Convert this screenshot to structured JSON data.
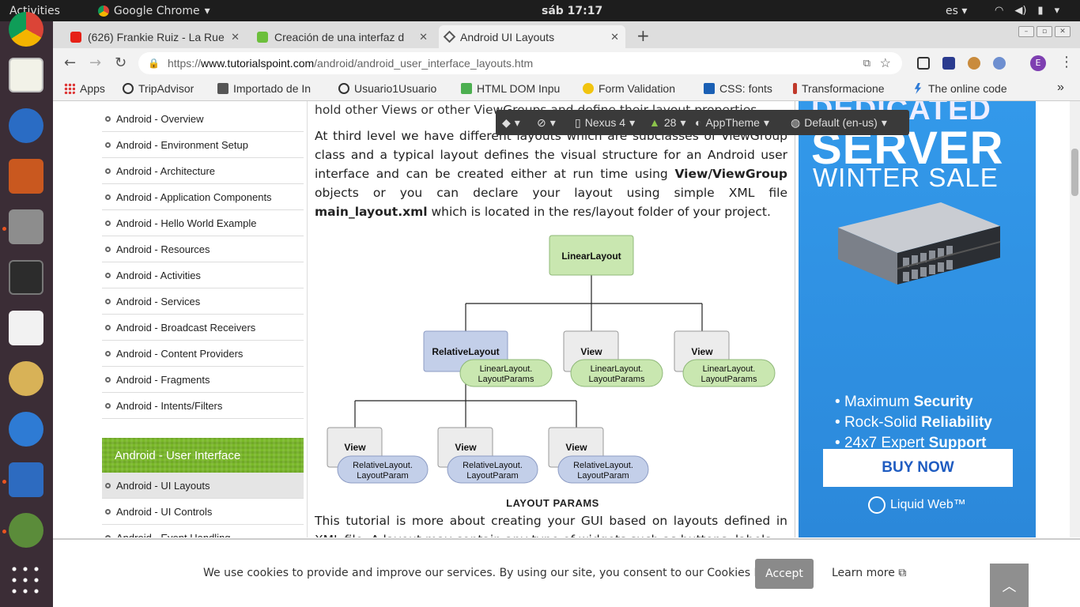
{
  "system": {
    "activities": "Activities",
    "app_name": "Google Chrome",
    "clock": "sáb 17:17",
    "language": "es"
  },
  "tabs": [
    {
      "title": "(626) Frankie Ruiz - La Rue",
      "icon": "youtube-icon"
    },
    {
      "title": "Creación de una interfaz d",
      "icon": "android-icon"
    },
    {
      "title": "Android UI Layouts",
      "icon": "tutorialspoint-icon",
      "active": true
    }
  ],
  "address": {
    "protocol": "https://",
    "host": "www.tutorialspoint.com",
    "path": "/android/android_user_interface_layouts.htm"
  },
  "bookmarks": [
    {
      "label": "Apps",
      "icon": "apps-grid-icon"
    },
    {
      "label": "TripAdvisor",
      "icon": "tripadvisor-icon"
    },
    {
      "label": "Importado de In",
      "icon": "folder-icon"
    },
    {
      "label": "Usuario1Usuario",
      "icon": "smiley-icon"
    },
    {
      "label": "HTML DOM Inpu",
      "icon": "w3-icon"
    },
    {
      "label": "Form Validation",
      "icon": "bulb-icon"
    },
    {
      "label": "CSS: fonts",
      "icon": "w3-icon"
    },
    {
      "label": "Transformacione",
      "icon": "info-icon"
    },
    {
      "label": "The online code",
      "icon": "bolt-icon"
    }
  ],
  "sidebar": {
    "items_top": [
      "Android - Overview",
      "Android - Environment Setup",
      "Android - Architecture",
      "Android - Application Components",
      "Android - Hello World Example",
      "Android - Resources",
      "Android - Activities",
      "Android - Services",
      "Android - Broadcast Receivers",
      "Android - Content Providers",
      "Android - Fragments",
      "Android - Intents/Filters"
    ],
    "section_header": "Android - User Interface",
    "items_bottom": [
      "Android - UI Layouts",
      "Android - UI Controls",
      "Android - Event Handling"
    ]
  },
  "content": {
    "para0": "hold other Views or other ViewGroups and define their layout properties.",
    "para1_a": "At third level we have different layouts which are subclasses of ViewGroup class and a typical layout defines the visual structure for an Android user interface and can be created either at run time using ",
    "para1_b": "View/ViewGroup",
    "para1_c": " objects or you can declare your layout using simple XML file ",
    "para1_d": "main_layout.xml",
    "para1_e": " which is located in the res/layout folder of your project.",
    "diagram": {
      "root": "LinearLayout",
      "level2": [
        "RelativeLayout",
        "View",
        "View"
      ],
      "level2_params": [
        "LinearLayout.",
        "LayoutParams"
      ],
      "level3": [
        "View",
        "View",
        "View"
      ],
      "level3_params": [
        "RelativeLayout.",
        "LayoutParam"
      ],
      "caption": "LAYOUT PARAMS"
    },
    "para2": "This tutorial is more about creating your GUI based on layouts defined in XML file. A layout may contain any type of widgets such as buttons, labels,"
  },
  "devtools": {
    "device": "Nexus 4",
    "api": "28",
    "theme": "AppTheme",
    "locale": "Default (en-us)"
  },
  "ad": {
    "line1": "DEDICATED",
    "line2": "SERVER",
    "line3": "WINTER SALE",
    "features": [
      {
        "plain": "Maximum ",
        "bold": "Security"
      },
      {
        "plain": "Rock-Solid ",
        "bold": "Reliability"
      },
      {
        "plain": "24x7 Expert ",
        "bold": "Support"
      }
    ],
    "cta": "BUY NOW",
    "brand": "Liquid Web™",
    "colors": {
      "bg": "#2d8fe1",
      "cta_text": "#1f5cc1"
    }
  },
  "cookie": {
    "message": "We use cookies to provide and improve our services. By using our site, you consent to our Cookies Policy.",
    "accept": "Accept",
    "learn_more": "Learn more"
  },
  "colors": {
    "sidebar_header": "#7ab929",
    "dock": "#3b2d36",
    "linear_fill": "#c9e7b0",
    "relative_fill": "#c3cfe9"
  }
}
